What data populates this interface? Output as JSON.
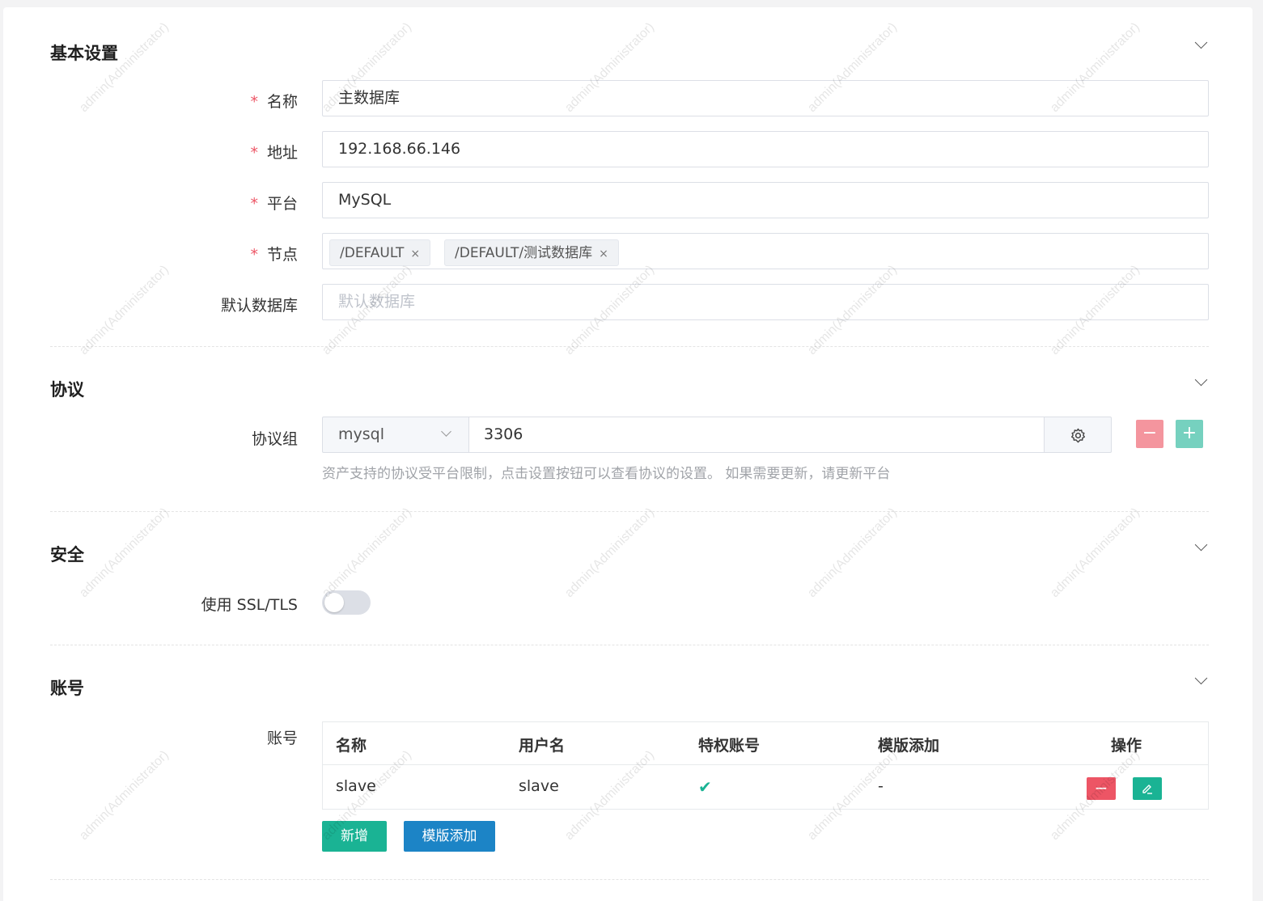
{
  "sections": {
    "basic": {
      "title": "基本设置",
      "fields": {
        "name": {
          "label": "名称",
          "value": "主数据库"
        },
        "address": {
          "label": "地址",
          "value": "192.168.66.146"
        },
        "platform": {
          "label": "平台",
          "value": "MySQL"
        },
        "nodes": {
          "label": "节点",
          "tags": [
            "/DEFAULT",
            "/DEFAULT/测试数据库"
          ]
        },
        "default_db": {
          "label": "默认数据库",
          "placeholder": "默认数据库"
        }
      },
      "required_mark": "*"
    },
    "protocol": {
      "title": "协议",
      "label": "协议组",
      "protocol": "mysql",
      "port": "3306",
      "help": "资产支持的协议受平台限制，点击设置按钮可以查看协议的设置。 如果需要更新，请更新平台"
    },
    "security": {
      "title": "安全",
      "label": "使用 SSL/TLS",
      "ssl_enabled": false
    },
    "accounts": {
      "title": "账号",
      "label": "账号",
      "columns": [
        "名称",
        "用户名",
        "特权账号",
        "模版添加",
        "操作"
      ],
      "rows": [
        {
          "name": "slave",
          "username": "slave",
          "privileged": "✔",
          "template": "-"
        }
      ],
      "add_button": "新增",
      "template_button": "模版添加"
    }
  },
  "watermark": "admin(Administrator)",
  "colors": {
    "primary": "#1ab394",
    "danger": "#ed5565",
    "info": "#1c84c6",
    "required": "#ed5565"
  },
  "icons": {
    "remove": "−",
    "add": "+",
    "close": "×"
  }
}
